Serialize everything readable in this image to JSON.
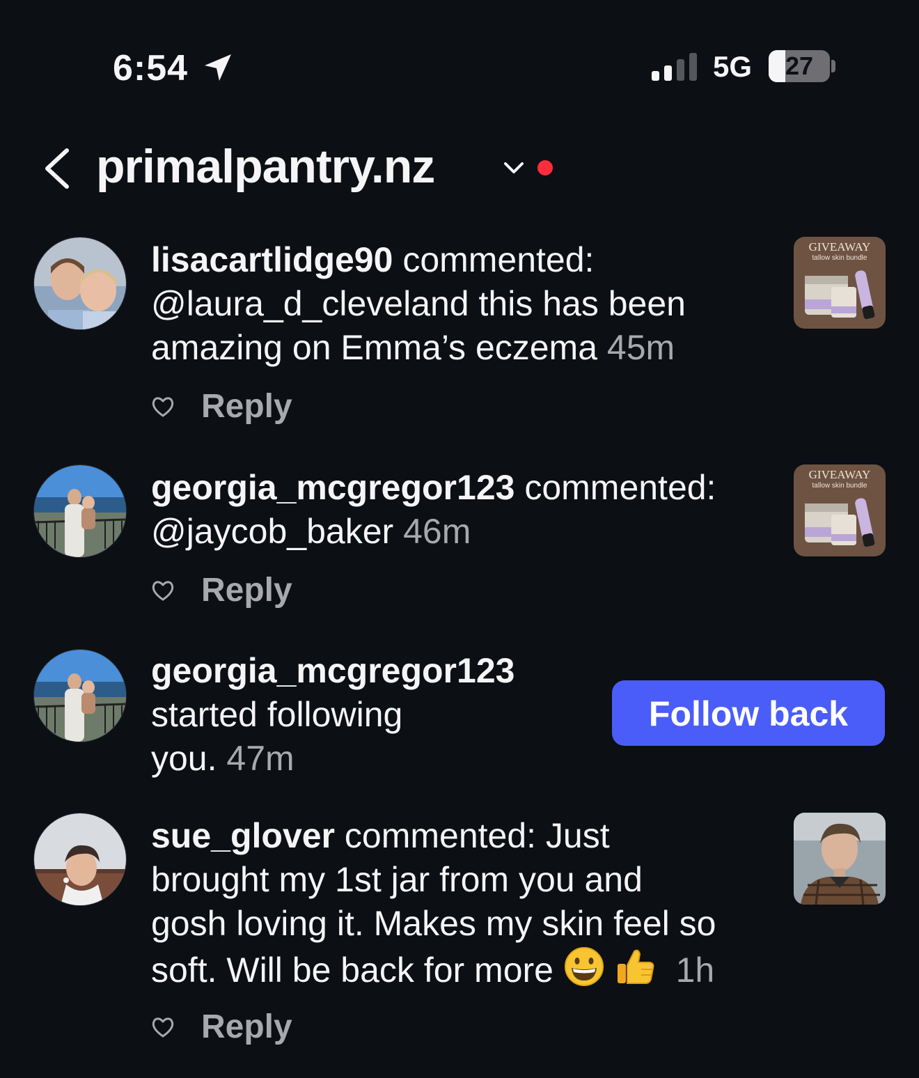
{
  "status": {
    "time": "6:54",
    "network": "5G",
    "battery_percent": 27,
    "battery_label": "27",
    "signal_bars_active": 2,
    "signal_bars_total": 4
  },
  "header": {
    "title": "primalpantry.nz"
  },
  "colors": {
    "background": "#0c0f14",
    "accent": "#4a5df9",
    "notification_dot": "#ff2d3d",
    "muted_text": "#a7a9ae"
  },
  "notifications": [
    {
      "username": "lisacartlidge90",
      "action": " commented:",
      "line2": "@laura_d_cleveland  this has been",
      "line3": "amazing on Emma’s eczema",
      "time": "45m",
      "reply_label": "Reply",
      "thumb": {
        "title": "GIVEAWAY",
        "subtitle": "tallow skin bundle"
      }
    },
    {
      "username": "georgia_mcgregor123",
      "action": " commented:",
      "line2": "@jaycob_baker",
      "time": "46m",
      "reply_label": "Reply",
      "thumb": {
        "title": "GIVEAWAY",
        "subtitle": "tallow skin bundle"
      }
    },
    {
      "username": "georgia_mcgregor123",
      "line2": "started following",
      "line3": "you.",
      "time": "47m",
      "button_label": "Follow back"
    },
    {
      "username": "sue_glover",
      "action": " commented: Just",
      "line2": "brought my 1st jar from you and",
      "line3": "gosh loving it. Makes my skin feel so",
      "line4": "soft. Will be back for more",
      "emojis": [
        "grinning-face-icon",
        "thumbs-up-icon"
      ],
      "time": "1h",
      "reply_label": "Reply"
    }
  ]
}
